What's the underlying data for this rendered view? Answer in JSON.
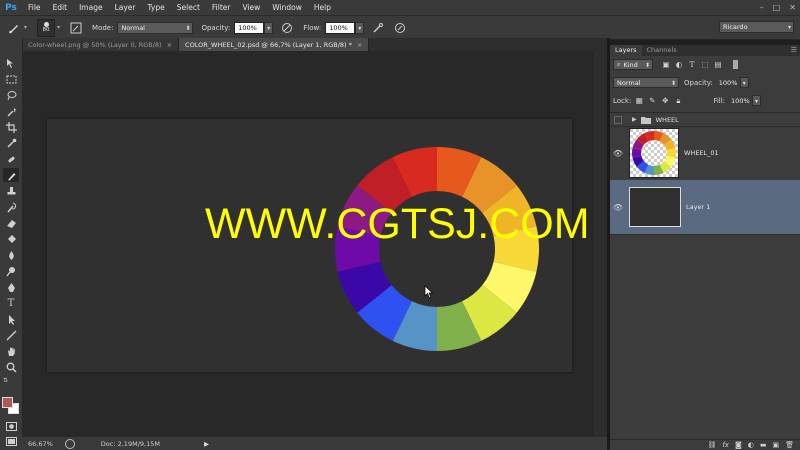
{
  "app": {
    "logo": "Ps"
  },
  "menubar": {
    "items": [
      "File",
      "Edit",
      "Image",
      "Layer",
      "Type",
      "Select",
      "Filter",
      "View",
      "Window",
      "Help"
    ],
    "window_controls": [
      "–",
      "□",
      "✕"
    ]
  },
  "options_bar": {
    "brush_size": "80",
    "mode_label": "Mode:",
    "mode_value": "Normal",
    "opacity_label": "Opacity:",
    "opacity_value": "100%",
    "flow_label": "Flow:",
    "flow_value": "100%",
    "workspace": "Ricardo"
  },
  "tabs": [
    {
      "label": "Color-wheel.png @ 50% (Layer 0, RGB/8)",
      "close": "×",
      "active": false
    },
    {
      "label": "COLOR_WHEEL_02.psd @ 66,7% (Layer 1, RGB/8) *",
      "close": "×",
      "active": true
    }
  ],
  "canvas": {
    "watermark": "WWW.CGTSJ.COM",
    "color_wheel_colors": [
      "#e6581c",
      "#e8932a",
      "#f0b428",
      "#f8d836",
      "#fef76a",
      "#dde744",
      "#7fb04a",
      "#5694c8",
      "#2f51f2",
      "#3b08a8",
      "#6e0aa8",
      "#8d1a82",
      "#c01f28",
      "#d82a1e"
    ]
  },
  "status": {
    "zoom": "66,67%",
    "doc_info": "Doc: 2,19M/9,15M",
    "arrow": "▶"
  },
  "layers_panel": {
    "tabs": [
      "Layers",
      "Channels"
    ],
    "filter_kind": "Kind",
    "blend_mode": "Normal",
    "opacity_label": "Opacity:",
    "opacity_value": "100%",
    "lock_label": "Lock:",
    "fill_label": "Fill:",
    "fill_value": "100%",
    "layers": [
      {
        "name": "WHEEL",
        "type": "group",
        "visible": false
      },
      {
        "name": "WHEEL_01",
        "type": "image",
        "visible": true
      },
      {
        "name": "Layer 1",
        "type": "fill",
        "visible": true,
        "selected": true
      }
    ],
    "bottom_icons": [
      "link-icon",
      "fx-icon",
      "mask-icon",
      "adjustment-icon",
      "folder-icon",
      "new-layer-icon",
      "trash-icon"
    ]
  },
  "colors": {
    "foreground": "#b05a55",
    "background": "#ffffff",
    "selection": "#5a6a80",
    "watermark": "#ffff00"
  }
}
